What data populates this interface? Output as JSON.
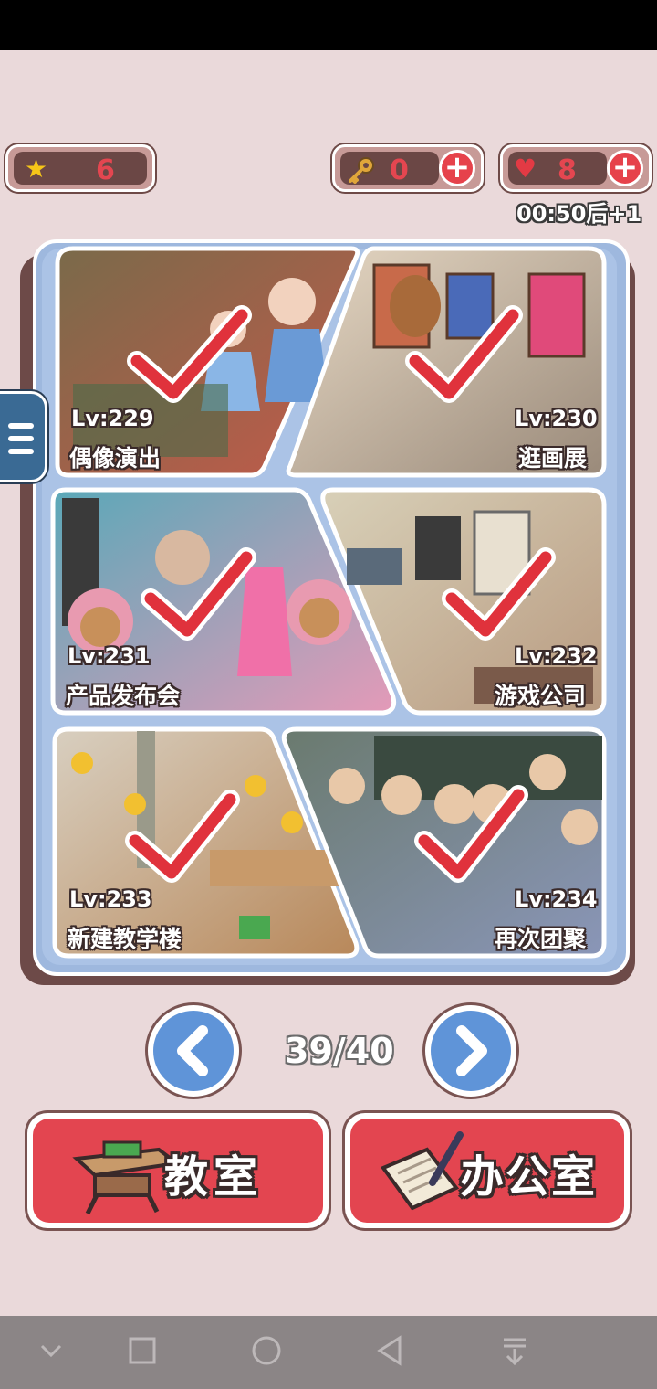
{
  "currency": {
    "stars": "6",
    "keys": "0",
    "hearts": "8",
    "heart_timer": "00:50后+1"
  },
  "levels": [
    {
      "lv": "Lv:229",
      "name": "偶像演出",
      "completed": true
    },
    {
      "lv": "Lv:230",
      "name": "逛画展",
      "completed": true
    },
    {
      "lv": "Lv:231",
      "name": "产品发布会",
      "completed": true
    },
    {
      "lv": "Lv:232",
      "name": "游戏公司",
      "completed": true
    },
    {
      "lv": "Lv:233",
      "name": "新建教学楼",
      "completed": true
    },
    {
      "lv": "Lv:234",
      "name": "再次团聚",
      "completed": true
    }
  ],
  "pagination": {
    "indicator": "39/40"
  },
  "buttons": {
    "classroom": "教室",
    "office": "办公室"
  },
  "colors": {
    "accent_red": "#e34550",
    "nav_blue": "#5f94d8",
    "board_blue": "#9eb8de",
    "check_red": "#e0323c"
  }
}
